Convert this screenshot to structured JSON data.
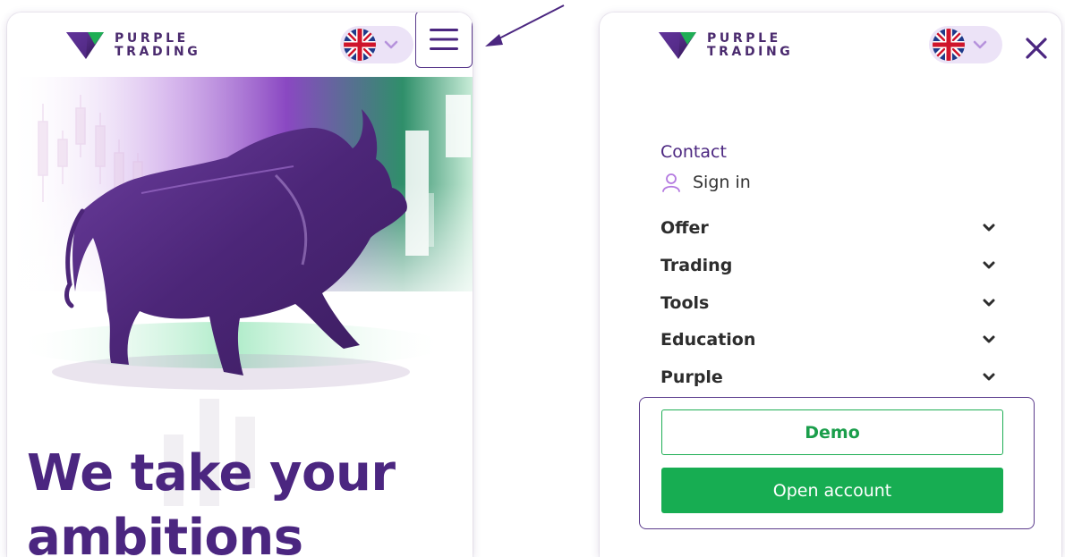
{
  "brand": {
    "line1": "PURPLE",
    "line2": "TRADING"
  },
  "language": {
    "current": "uk-flag-icon"
  },
  "hero": {
    "headline_line1": "We take your",
    "headline_line2": "ambitions"
  },
  "menu": {
    "contact": "Contact",
    "sign_in": "Sign in",
    "items": [
      {
        "label": "Offer"
      },
      {
        "label": "Trading"
      },
      {
        "label": "Tools"
      },
      {
        "label": "Education"
      },
      {
        "label": "Purple"
      }
    ],
    "demo_label": "Demo",
    "open_account_label": "Open account"
  },
  "colors": {
    "brand_purple": "#4b2680",
    "accent_green": "#17ad52",
    "lang_pill": "#ece3f7",
    "outline_purple": "#5b3b8c"
  }
}
